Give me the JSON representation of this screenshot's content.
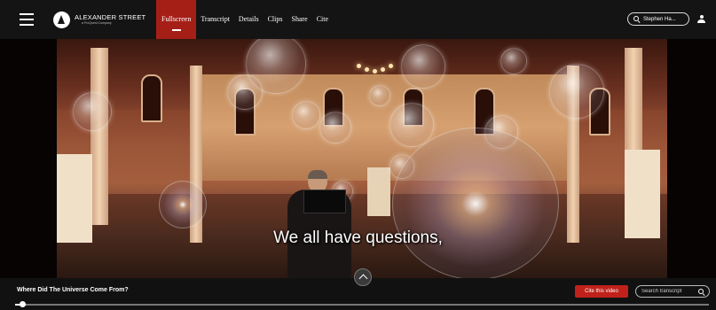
{
  "header": {
    "logo_title": "ALEXANDER STREET",
    "logo_subtitle": "a ProQuest Company",
    "tabs": [
      {
        "label": "Fullscreen",
        "active": true
      },
      {
        "label": "Transcript",
        "active": false
      },
      {
        "label": "Details",
        "active": false
      },
      {
        "label": "Clips",
        "active": false
      },
      {
        "label": "Share",
        "active": false
      },
      {
        "label": "Cite",
        "active": false
      }
    ],
    "search_text": "Stephen Ha...",
    "accent_color": "#a61f17"
  },
  "video": {
    "caption": "We all have questions,"
  },
  "controls": {
    "title": "Where Did The Universe Come From?",
    "cite_label": "Cite this video",
    "transcript_search_placeholder": "Search transcript",
    "progress": 0.01
  },
  "icons": [
    "hamburger-menu-icon",
    "logo-icon",
    "search-icon",
    "user-icon",
    "chevron-up-icon"
  ]
}
